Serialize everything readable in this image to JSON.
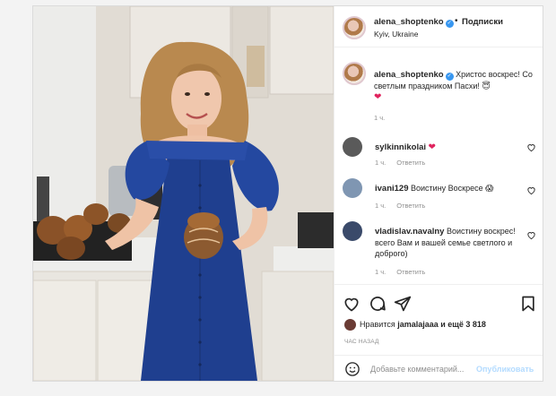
{
  "post": {
    "username": "alena_shoptenko",
    "follow_label": "Подписки",
    "location": "Kyiv, Ukraine",
    "verified_mark": "✓",
    "caption_text": "Христос воскрес! Со светлым праздником Пасхи! 😇",
    "caption_time": "1 ч."
  },
  "comments": [
    {
      "user": "sylkinnikolai",
      "text": "",
      "time": "1 ч.",
      "reply": "Ответить",
      "avatar_color": "#5a5a5a"
    },
    {
      "user": "ivani129",
      "text": "Воистину Воскресе 😱",
      "time": "1 ч.",
      "reply": "Ответить",
      "avatar_color": "#7f96b2"
    },
    {
      "user": "vladislav.navalny",
      "text": "Воистину воскрес! всего Вам и вашей семье светлого и доброго)",
      "time": "1 ч.",
      "reply": "Ответить",
      "avatar_color": "#3a4a6a"
    }
  ],
  "actions": {
    "likes_prefix": "Нравится ",
    "likes_user": "jamalajaaa",
    "likes_suffix": " и ещё 3 818",
    "time_ago": "ЧАС НАЗАД",
    "comment_placeholder": "Добавьте комментарий...",
    "publish_label": "Опубликовать"
  },
  "icons": [
    "heart-outline-icon",
    "comment-icon",
    "share-icon",
    "bookmark-icon",
    "smile-icon"
  ],
  "colors": {
    "verified": "#3897f0",
    "heart": "#e0245e",
    "dress": "#1f3f8f",
    "publish": "#b3dbff"
  }
}
